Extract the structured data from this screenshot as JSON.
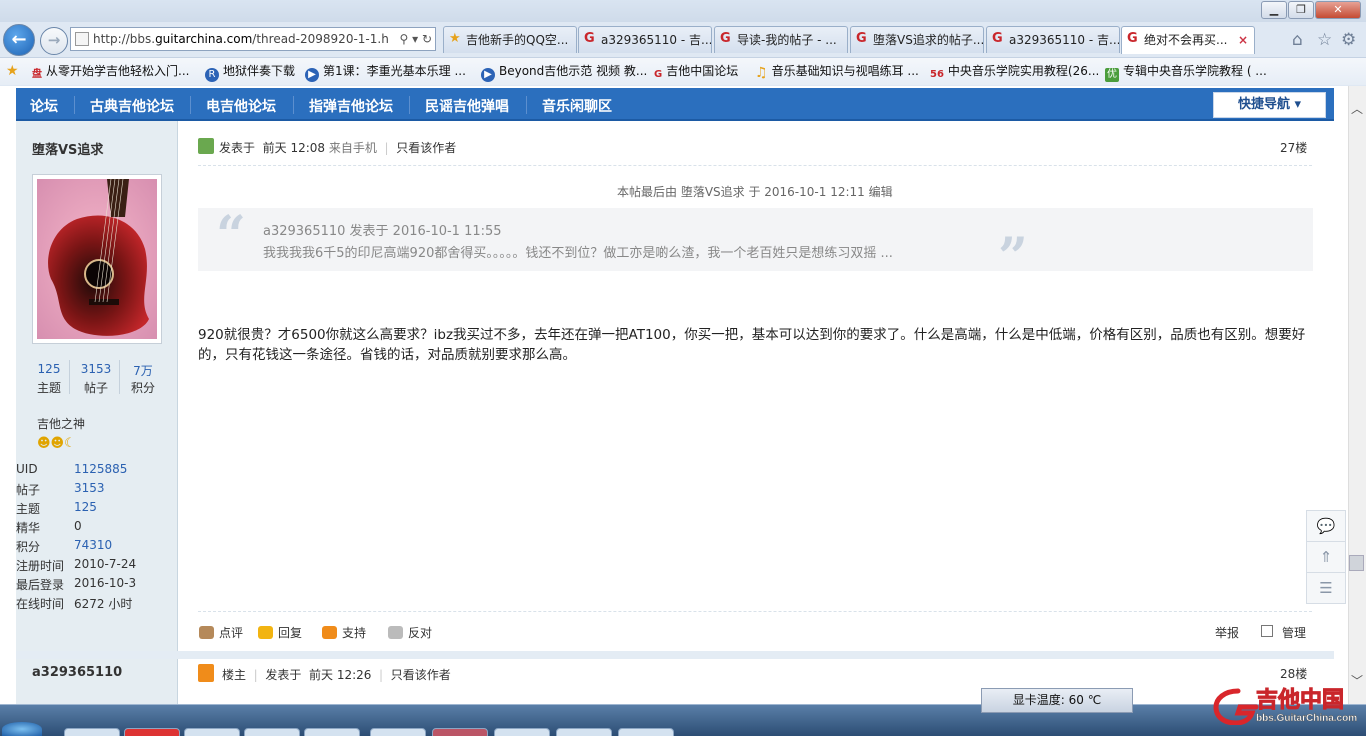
{
  "browser": {
    "address_url": "http://bbs.guitarchina.com/thread-2098920-1-1.h",
    "address_url_prefix": "http://bbs.",
    "address_url_domain": "guitarchina.com",
    "address_url_suffix": "/thread-2098920-1-1.h",
    "tabs": [
      {
        "label": "吉他新手的QQ空...",
        "icon": "star-icon"
      },
      {
        "label": "a329365110 - 吉...",
        "icon": "gc-logo-icon"
      },
      {
        "label": "导读-我的帖子 - ...",
        "icon": "gc-logo-icon"
      },
      {
        "label": "堕落VS追求的帖子...",
        "icon": "gc-logo-icon"
      },
      {
        "label": "a329365110 - 吉...",
        "icon": "gc-logo-icon"
      },
      {
        "label": "绝对不会再买...",
        "icon": "gc-logo-icon"
      }
    ],
    "favorites": [
      {
        "label": "从零开始学吉他轻松入门...",
        "prefix": "盘"
      },
      {
        "label": "地狱伴奏下载",
        "prefix": "R"
      },
      {
        "label": "第1课：李重光基本乐理 ...",
        "prefix": "▶"
      },
      {
        "label": "Beyond吉他示范 视频 教...",
        "prefix": "▶"
      },
      {
        "label": "吉他中国论坛",
        "prefix": "G"
      },
      {
        "label": "音乐基础知识与视唱练耳 ...",
        "prefix": "♫"
      },
      {
        "label": "中央音乐学院实用教程(26...",
        "prefix": "56"
      },
      {
        "label": "专辑中央音乐学院教程 ( ...",
        "prefix": "优"
      }
    ]
  },
  "forum_nav": {
    "items": [
      "论坛",
      "古典吉他论坛",
      "电吉他论坛",
      "指弹吉他论坛",
      "民谣吉他弹唱",
      "音乐闲聊区"
    ],
    "quick_nav": "快捷导航 ▾"
  },
  "post1": {
    "author": "堕落VS追求",
    "stats": [
      {
        "num": "125",
        "label": "主题"
      },
      {
        "num": "3153",
        "label": "帖子"
      },
      {
        "num": "7万",
        "label": "积分"
      }
    ],
    "rank": "吉他之神",
    "info": [
      {
        "k": "UID",
        "v": "1125885",
        "link": true
      },
      {
        "k": "帖子",
        "v": "3153",
        "link": true
      },
      {
        "k": "主题",
        "v": "125",
        "link": true
      },
      {
        "k": "精华",
        "v": "0",
        "link": false
      },
      {
        "k": "积分",
        "v": "74310",
        "link": true
      },
      {
        "k": "注册时间",
        "v": "2010-7-24",
        "link": false
      },
      {
        "k": "最后登录",
        "v": "2016-10-3",
        "link": false
      },
      {
        "k": "在线时间",
        "v": "6272 小时",
        "link": false
      }
    ],
    "posted_prefix": "发表于",
    "posted_time": "前天 12:08",
    "posted_from": "来自手机",
    "only_author": "只看该作者",
    "floor": "27楼",
    "edit_note": "本帖最后由  堕落VS追求  于  2016-10-1 12:11  编辑",
    "quote_head": "a329365110 发表于  2016-10-1 11:55",
    "quote_body": "我我我我6千5的印尼高端920都舍得买。。。。。钱还不到位？做工亦是啲么渣，我一个老百姓只是想练习双摇 ...",
    "body": "920就很贵？才6500你就这么高要求？ibz我买过不多，去年还在弹一把AT100，你买一把，基本可以达到你的要求了。什么是高端，什么是中低端，价格有区别，品质也有区别。想要好的，只有花钱这一条途径。省钱的话，对品质就别要求那么高。",
    "actions": [
      "点评",
      "回复",
      "支持",
      "反对"
    ],
    "report": "举报",
    "manage": "管理"
  },
  "post2": {
    "author": "a329365110",
    "role": "楼主",
    "posted_prefix": "发表于",
    "posted_time": "前天 12:26",
    "only_author": "只看该作者",
    "floor": "28楼"
  },
  "gpu_temp": "显卡温度: 60 ℃",
  "watermark": {
    "title": "吉他中国",
    "site": "bbs.GuitarChina.com"
  },
  "colors": {
    "forum_blue": "#2b6fbe",
    "link_blue": "#2b61b1",
    "sidebar_bg": "#e5edf2"
  }
}
